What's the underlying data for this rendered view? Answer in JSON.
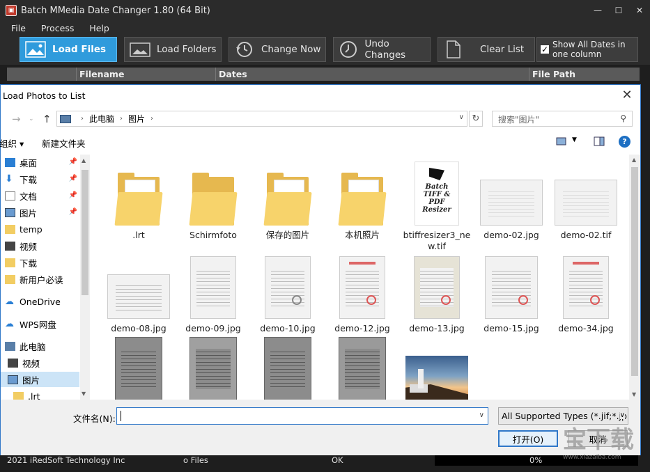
{
  "app": {
    "title": "Batch MMedia Date Changer 1.80 (64 Bit)",
    "menu": [
      "File",
      "Process",
      "Help"
    ],
    "toolbar": {
      "load_files": "Load Files",
      "load_folders": "Load Folders",
      "change_now": "Change Now",
      "undo_changes": "Undo Changes",
      "clear_list": "Clear List",
      "show_all_dates_line1": "Show All Dates in",
      "show_all_dates_line2": "one column",
      "show_all_dates_checked": true
    },
    "grid_columns": [
      "Filename",
      "Dates",
      "File Path"
    ],
    "status": {
      "copyright": "2021 iRedSoft Technology Inc",
      "files": "o Files",
      "state": "OK",
      "progress": "0%"
    },
    "colors": {
      "accent": "#2f9bdc",
      "background": "#2b2b2b"
    }
  },
  "dialog": {
    "title": "Load Photos to List",
    "breadcrumb": [
      "此电脑",
      "图片"
    ],
    "search_placeholder": "搜索\"图片\"",
    "organize": "组织",
    "new_folder": "新建文件夹",
    "nav": [
      {
        "label": "桌面",
        "icon": "desktop-icon",
        "pinned": true
      },
      {
        "label": "下载",
        "icon": "download-icon",
        "pinned": true
      },
      {
        "label": "文档",
        "icon": "document-icon",
        "pinned": true
      },
      {
        "label": "图片",
        "icon": "picture-icon",
        "pinned": true
      },
      {
        "label": "temp",
        "icon": "folder-icon",
        "pinned": false
      },
      {
        "label": "视频",
        "icon": "video-icon",
        "pinned": false
      },
      {
        "label": "下载",
        "icon": "folder-icon",
        "pinned": false
      },
      {
        "label": "新用户必读",
        "icon": "folder-icon",
        "pinned": false
      },
      {
        "label": "OneDrive",
        "icon": "cloud-icon",
        "pinned": false
      },
      {
        "label": "WPS网盘",
        "icon": "cloud-icon",
        "pinned": false
      },
      {
        "label": "此电脑",
        "icon": "computer-icon",
        "pinned": false
      },
      {
        "label": "视频",
        "icon": "video-icon",
        "pinned": false
      },
      {
        "label": "图片",
        "icon": "picture-icon",
        "pinned": false,
        "selected": true
      },
      {
        "label": ".lrt",
        "icon": "folder-icon",
        "pinned": false
      }
    ],
    "files": [
      {
        "name": ".lrt",
        "kind": "folder"
      },
      {
        "name": "Schirmfoto",
        "kind": "folder"
      },
      {
        "name": "保存的图片",
        "kind": "folder"
      },
      {
        "name": "本机照片",
        "kind": "folder"
      },
      {
        "name": "btiffresizer3_new.tif",
        "kind": "tiff"
      },
      {
        "name": "demo-02.jpg",
        "kind": "drawing"
      },
      {
        "name": "demo-02.tif",
        "kind": "drawing"
      },
      {
        "name": "demo-08.jpg",
        "kind": "doc-land"
      },
      {
        "name": "demo-09.jpg",
        "kind": "doc"
      },
      {
        "name": "demo-10.jpg",
        "kind": "doc"
      },
      {
        "name": "demo-12.jpg",
        "kind": "doc-red"
      },
      {
        "name": "demo-13.jpg",
        "kind": "doc"
      },
      {
        "name": "demo-15.jpg",
        "kind": "doc-stamp"
      },
      {
        "name": "demo-34.jpg",
        "kind": "doc-red"
      },
      {
        "name": "",
        "kind": "doc-gray"
      },
      {
        "name": "",
        "kind": "doc-gray"
      },
      {
        "name": "",
        "kind": "doc-gray"
      },
      {
        "name": "",
        "kind": "doc-gray"
      },
      {
        "name": "",
        "kind": "photo"
      }
    ],
    "tiff_text": [
      "Batch",
      "TIFF &",
      "PDF",
      "Resizer"
    ],
    "filename_label": "文件名(N):",
    "filename_value": "",
    "type_filter": "All Supported Types (*.jif;*.jp",
    "open_label": "打开(O)",
    "cancel_label": "取消"
  },
  "watermark": {
    "main": "宝下载",
    "sub": "www.xiazaiba.com"
  }
}
